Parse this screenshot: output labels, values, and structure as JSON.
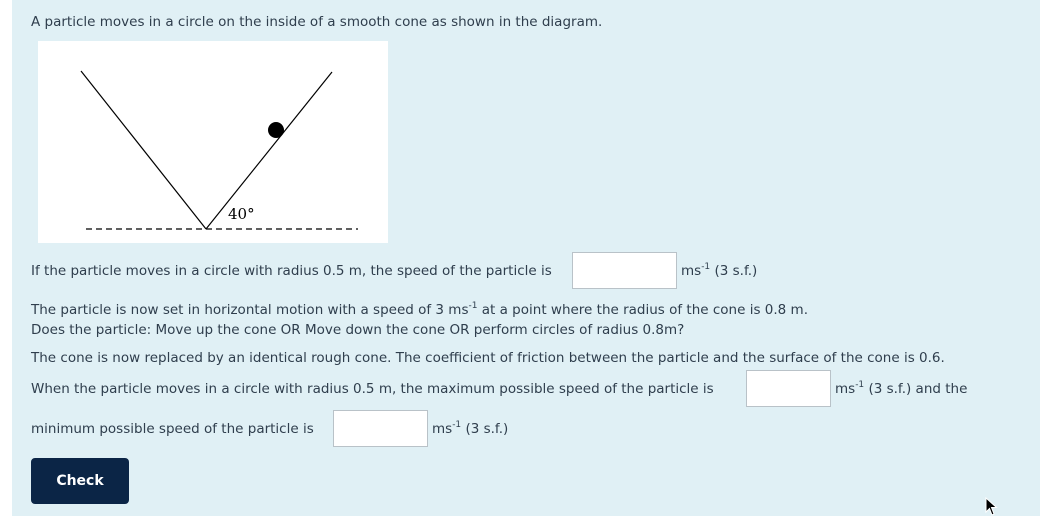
{
  "question": {
    "intro": "A particle moves in a circle on the inside of a smooth cone as shown in the diagram.",
    "diagram": {
      "angle_label": "40°"
    },
    "part1": {
      "text_before": "If the particle moves in a circle with radius 0.5 m, the speed of the particle is",
      "unit": "ms",
      "unit_sup": "-1",
      "note": "(3 s.f.)",
      "answer_value": ""
    },
    "part2": {
      "line1_before": "The particle is now set in horizontal motion with a speed of 3 ms",
      "line1_sup": "-1",
      "line1_after": " at a point where the radius of the cone is 0.8 m.",
      "line2": "Does the particle: Move up the cone OR Move down the cone OR perform circles of radius 0.8m?"
    },
    "part3": {
      "line1": "The cone is now replaced by an identical rough cone. The coefficient of friction between the particle and the surface of the cone is 0.6.",
      "line2_before": "When the particle moves in a circle with radius 0.5 m, the maximum possible speed of the particle is",
      "line2_unit": "ms",
      "line2_sup": "-1",
      "line2_after": " (3 s.f.) and the",
      "line3_before": "minimum possible speed of the particle is",
      "line3_unit": "ms",
      "line3_sup": "-1",
      "line3_after": " (3 s.f.)",
      "max_value": "",
      "min_value": ""
    }
  },
  "buttons": {
    "check_label": "Check"
  },
  "colors": {
    "panel_bg": "#e0f0f5",
    "button_bg": "#0b2546"
  }
}
